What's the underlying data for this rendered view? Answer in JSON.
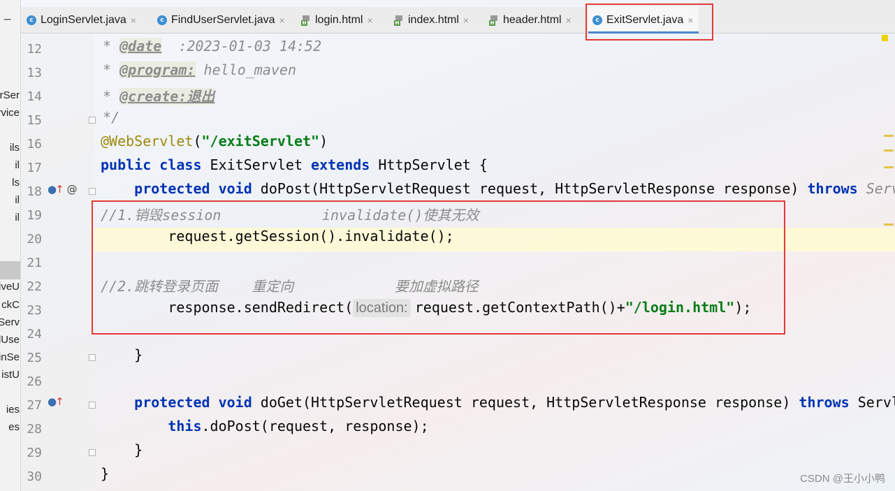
{
  "tabs": [
    {
      "label": "LoginServlet.java",
      "icon": "c",
      "active": false
    },
    {
      "label": "FindUserServlet.java",
      "icon": "c",
      "active": false
    },
    {
      "label": "login.html",
      "icon": "h",
      "active": false
    },
    {
      "label": "index.html",
      "icon": "h",
      "active": false
    },
    {
      "label": "header.html",
      "icon": "h",
      "active": false
    },
    {
      "label": "ExitServlet.java",
      "icon": "c",
      "active": true
    }
  ],
  "close_glyph": "×",
  "project_strip": {
    "collapse_glyph": "−",
    "items": [
      "rSer",
      "rvice",
      "ils",
      "il",
      "ls",
      "il",
      "il",
      "iveU",
      "ckC",
      "Serv",
      "dUse",
      "inSe",
      "istU",
      "ies",
      "es"
    ]
  },
  "lines": [
    {
      "n": "12",
      "parts": [
        [
          "doc",
          " * "
        ],
        [
          "doctag",
          "@date"
        ],
        [
          "doc",
          "  :2023-01-03 14:52"
        ]
      ]
    },
    {
      "n": "13",
      "parts": [
        [
          "doc",
          " * "
        ],
        [
          "doctag",
          "@program:"
        ],
        [
          "doc",
          " hello_maven"
        ]
      ]
    },
    {
      "n": "14",
      "parts": [
        [
          "doc",
          " * "
        ],
        [
          "doctag",
          "@create:退出"
        ]
      ]
    },
    {
      "n": "15",
      "parts": [
        [
          "doc",
          " */"
        ]
      ]
    },
    {
      "n": "16",
      "parts": [
        [
          "ann",
          "@WebServlet"
        ],
        [
          "",
          "("
        ],
        [
          "str",
          "\"/exitServlet\""
        ],
        [
          "",
          ")"
        ]
      ]
    },
    {
      "n": "17",
      "parts": [
        [
          "kw",
          "public class"
        ],
        [
          "",
          " ExitServlet "
        ],
        [
          "kw",
          "extends"
        ],
        [
          "",
          " HttpServlet {"
        ]
      ]
    },
    {
      "n": "18",
      "parts": [
        [
          "",
          "    "
        ],
        [
          "kw",
          "protected void"
        ],
        [
          "",
          " doPost(HttpServletRequest request, HttpServletResponse response) "
        ],
        [
          "kw",
          "throws"
        ],
        [
          "cmt",
          " Serv"
        ]
      ]
    },
    {
      "n": "19",
      "parts": [
        [
          "cmt",
          "//1.销毁session            invalidate()使其无效"
        ]
      ]
    },
    {
      "n": "20",
      "parts": [
        [
          "",
          "        request.getSession().invalidate();"
        ]
      ]
    },
    {
      "n": "21",
      "parts": []
    },
    {
      "n": "22",
      "parts": [
        [
          "cmt",
          "//2.跳转登录页面    重定向            要加虚拟路径"
        ]
      ]
    },
    {
      "n": "23",
      "parts": [
        [
          "",
          "        response.sendRedirect("
        ],
        [
          "hint",
          "location:"
        ],
        [
          "",
          "request.getContextPath()+"
        ],
        [
          "str",
          "\"/login.html\""
        ],
        [
          "",
          ");"
        ]
      ]
    },
    {
      "n": "24",
      "parts": []
    },
    {
      "n": "25",
      "parts": [
        [
          "",
          "    }"
        ]
      ]
    },
    {
      "n": "26",
      "parts": []
    },
    {
      "n": "27",
      "parts": [
        [
          "",
          "    "
        ],
        [
          "kw",
          "protected void"
        ],
        [
          "",
          " doGet(HttpServletRequest request, HttpServletResponse response) "
        ],
        [
          "kw",
          "throws"
        ],
        [
          "",
          " Servl"
        ]
      ]
    },
    {
      "n": "28",
      "parts": [
        [
          "",
          "        "
        ],
        [
          "kw",
          "this"
        ],
        [
          "",
          ".doPost(request, response);"
        ]
      ]
    },
    {
      "n": "29",
      "parts": [
        [
          "",
          "    }"
        ]
      ]
    },
    {
      "n": "30",
      "parts": [
        [
          "",
          "}"
        ]
      ]
    }
  ],
  "gutter_markers": {
    "line18": {
      "impl": "●",
      "up": "↑",
      "at": "@"
    },
    "line27": {
      "impl": "●",
      "up": "↑"
    }
  },
  "watermark": "CSDN @王小小鸭"
}
